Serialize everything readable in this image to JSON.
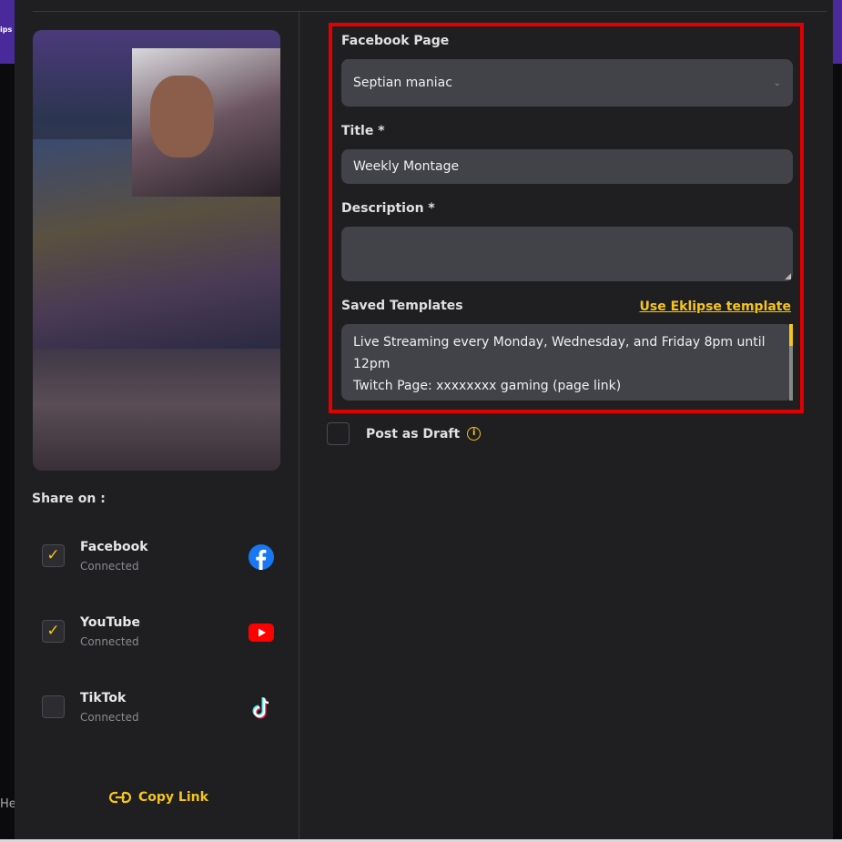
{
  "background": {
    "left_hint": "ips a",
    "help": "Hel"
  },
  "share": {
    "title": "Share on :",
    "platforms": [
      {
        "name": "Facebook",
        "status": "Connected",
        "checked": true,
        "icon": "facebook-icon"
      },
      {
        "name": "YouTube",
        "status": "Connected",
        "checked": true,
        "icon": "youtube-icon"
      },
      {
        "name": "TikTok",
        "status": "Connected",
        "checked": false,
        "icon": "tiktok-icon"
      }
    ],
    "check_mark": "✓",
    "copy_link": "Copy Link"
  },
  "form": {
    "facebook_page_label": "Facebook Page",
    "facebook_page_value": "Septian maniac",
    "title_label": "Title *",
    "title_value": "Weekly Montage",
    "description_label": "Description *",
    "description_value": "",
    "templates_label": "Saved Templates",
    "use_template_link": "Use Eklipse template",
    "template_line1": "Live Streaming every Monday, Wednesday, and Friday 8pm until 12pm",
    "template_line2": "Twitch Page: xxxxxxxx gaming (page link)"
  },
  "draft": {
    "label": "Post as Draft",
    "checked": false,
    "info": "i"
  },
  "colors": {
    "accent": "#f5c518",
    "highlight_border": "#e00000",
    "panel": "#1f1f22",
    "field": "#424249"
  }
}
